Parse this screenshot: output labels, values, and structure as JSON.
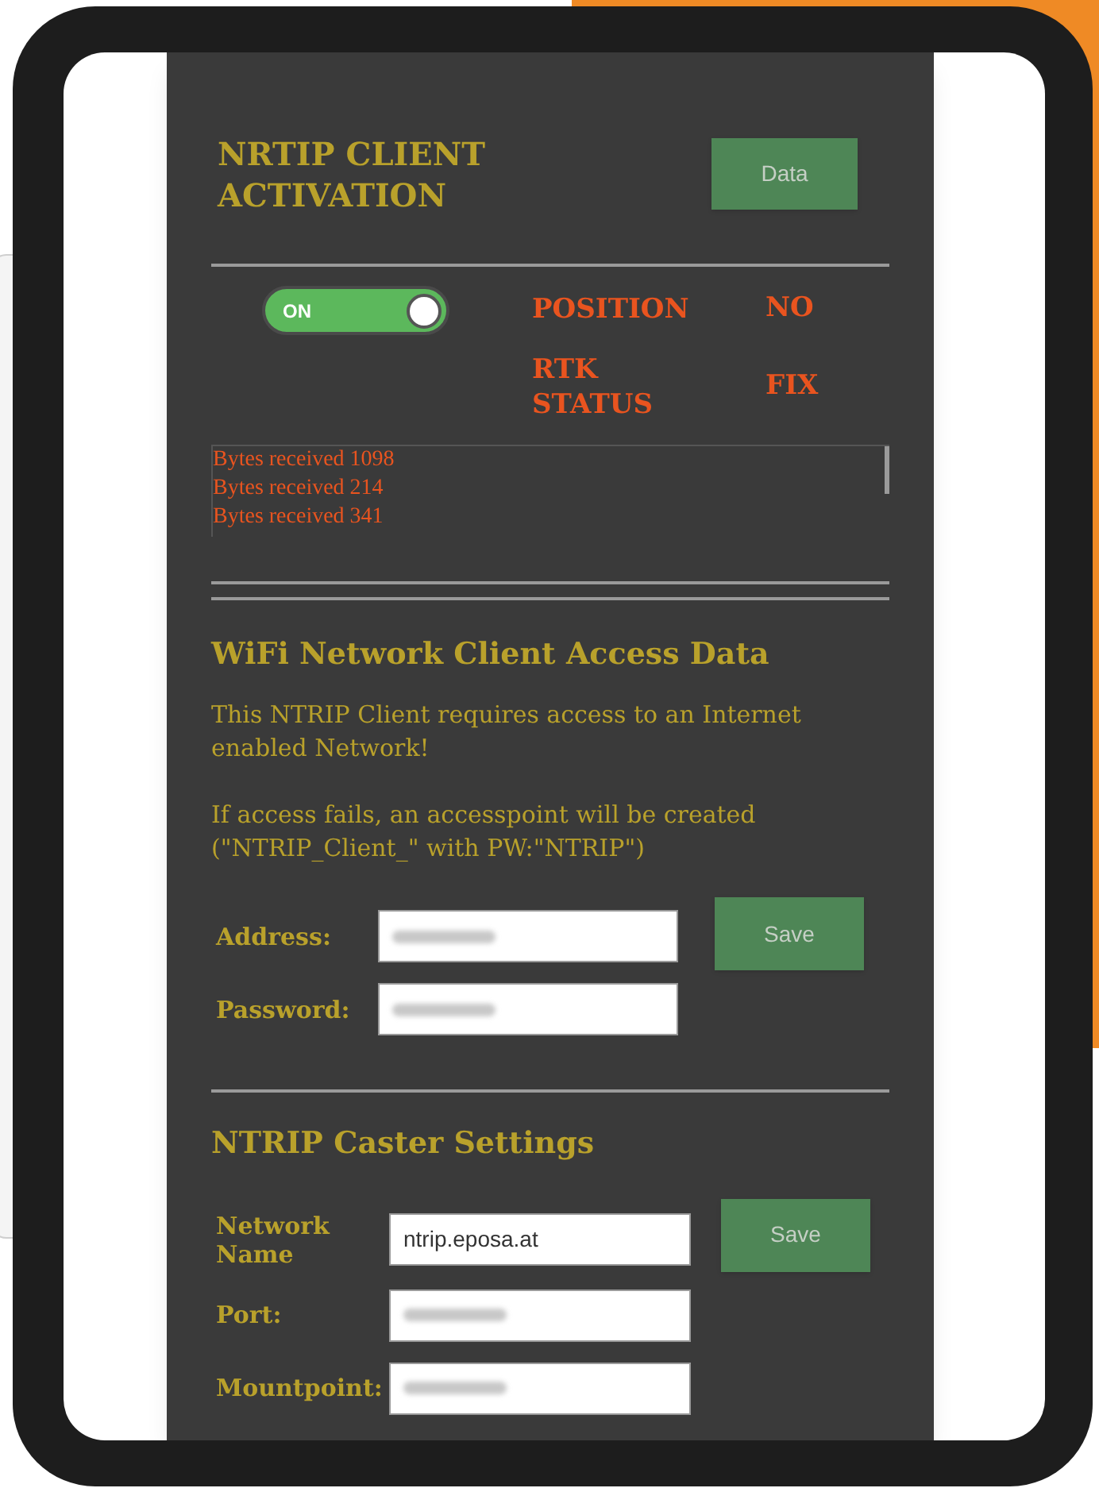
{
  "activation": {
    "title": "NRTIP CLIENT ACTIVATION",
    "data_button": "Data",
    "toggle": {
      "label": "ON",
      "on": true
    }
  },
  "status": [
    {
      "label": "POSITION",
      "value": "NO"
    },
    {
      "label": "RTK STATUS",
      "value": "FIX"
    }
  ],
  "log": [
    "Bytes received 1098",
    "Bytes received 214",
    "Bytes received 341"
  ],
  "wifi": {
    "title": "WiFi Network Client Access Data",
    "paragraphs": [
      "This NTRIP Client requires access to an Internet enabled Network!",
      "If access fails, an accesspoint will be created (\"NTRIP_Client_\" with PW:\"NTRIP\")"
    ],
    "fields": [
      {
        "label": "Address:",
        "redacted": true
      },
      {
        "label": "Password:",
        "redacted": true
      }
    ],
    "save_button": "Save"
  },
  "caster": {
    "title": "NTRIP Caster Settings",
    "fields": [
      {
        "label": "Network Name",
        "value": "ntrip.eposa.at",
        "redacted": false
      },
      {
        "label": "Port:",
        "redacted": true
      },
      {
        "label": "Mountpoint:",
        "redacted": true
      }
    ],
    "save_button": "Save"
  }
}
